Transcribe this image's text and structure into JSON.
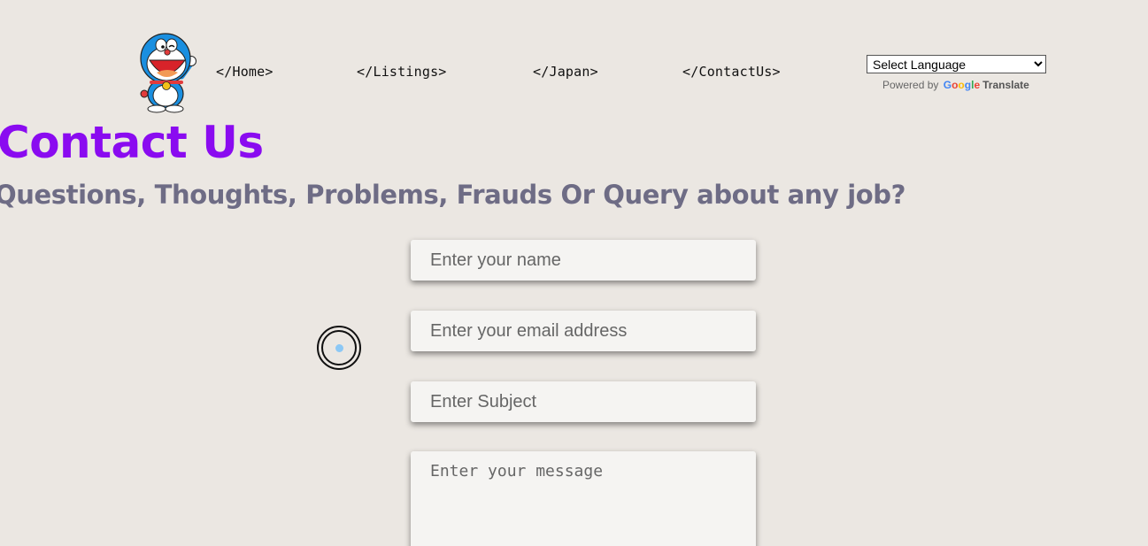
{
  "nav": {
    "logo_icon": "doraemon-logo-icon",
    "items": [
      {
        "label": "</Home>"
      },
      {
        "label": "</Listings>"
      },
      {
        "label": "</Japan>"
      },
      {
        "label": "</ContactUs>"
      }
    ]
  },
  "translate": {
    "selected": "Select Language",
    "powered_by": "Powered by",
    "google_letters": [
      "G",
      "o",
      "o",
      "g",
      "l",
      "e"
    ],
    "translate_label": "Translate"
  },
  "main": {
    "title": "Contact Us",
    "subtitle": "Questions, Thoughts, Problems, Frauds Or Query about any job?"
  },
  "form": {
    "name_placeholder": "Enter your name",
    "email_placeholder": "Enter your email address",
    "subject_placeholder": "Enter Subject",
    "message_placeholder": "Enter your message"
  },
  "colors": {
    "background": "#ebe7e2",
    "title": "#8a0bf0",
    "subtitle": "#6e6c85",
    "field_bg": "#f5f4f2"
  }
}
